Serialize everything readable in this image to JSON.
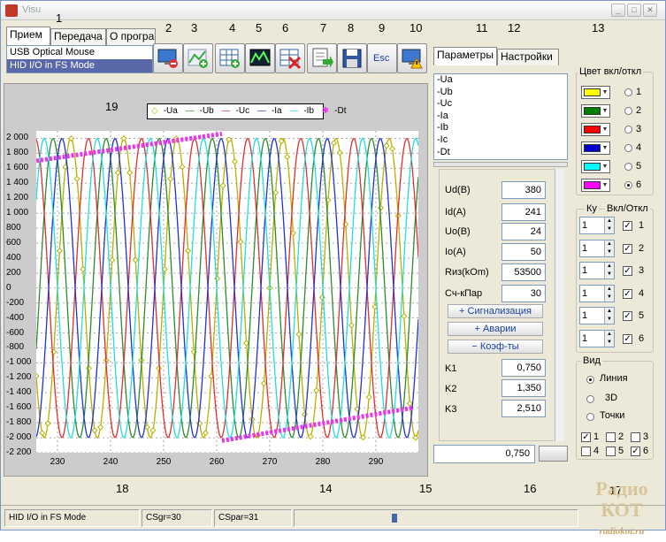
{
  "window": {
    "title": "Visu"
  },
  "tabs_left": [
    "Прием",
    "Передача",
    "О програ"
  ],
  "devices": [
    "USB Optical Mouse",
    "HID I/O in FS Mode"
  ],
  "toolbar": {
    "esc_label": "Esc"
  },
  "callouts": [
    "1",
    "2",
    "3",
    "4",
    "5",
    "6",
    "7",
    "8",
    "9",
    "10",
    "11",
    "12",
    "13",
    "14",
    "15",
    "16",
    "17",
    "18",
    "19"
  ],
  "legend": {
    "items": [
      "-Ua",
      "-Ub",
      "-Uc",
      "-Ia",
      "-Ib",
      "-Dt"
    ]
  },
  "chart_data": {
    "type": "line",
    "title": "",
    "xlabel": "",
    "ylabel": "",
    "xlim": [
      226,
      298
    ],
    "ylim": [
      -2200,
      2100
    ],
    "xticks": [
      230,
      240,
      250,
      260,
      270,
      280,
      290
    ],
    "yticks": [
      2000,
      1800,
      1600,
      1400,
      1200,
      1000,
      800,
      600,
      400,
      200,
      0,
      -200,
      -400,
      -600,
      -800,
      -1000,
      -1200,
      -1400,
      -1600,
      -1800,
      -2000,
      -2200
    ],
    "ytick_labels": [
      "2 000",
      "1 800",
      "1 600",
      "1 400",
      "1 200",
      "1 000",
      "800",
      "600",
      "400",
      "200",
      "0",
      "-200",
      "-400",
      "-600",
      "-800",
      "-1 000",
      "-1 200",
      "-1 400",
      "-1 600",
      "-1 800",
      "-2 000",
      "-2 200"
    ],
    "grid": true,
    "legend_position": "top",
    "series": [
      {
        "name": "-Ua",
        "color": "#b8b000",
        "amplitude": 2000,
        "period": 10,
        "phase": 0
      },
      {
        "name": "-Ub",
        "color": "#2e8b2e",
        "amplitude": 2000,
        "period": 10,
        "phase": 120
      },
      {
        "name": "-Uc",
        "color": "#dd3030",
        "amplitude": 2000,
        "period": 10,
        "phase": 240
      },
      {
        "name": "-Ia",
        "color": "#2233cc",
        "amplitude": 2000,
        "period": 10,
        "phase": 60
      },
      {
        "name": "-Ib",
        "color": "#22dddd",
        "amplitude": 2000,
        "period": 10,
        "phase": 180
      },
      {
        "name": "-Dt",
        "color": "#ee33ee",
        "segments": [
          [
            [
              226,
              1700
            ],
            [
              261,
              2060
            ]
          ],
          [
            [
              261,
              -2040
            ],
            [
              297,
              -1600
            ]
          ]
        ]
      }
    ]
  },
  "right_tabs": [
    "Параметры",
    "Настройки"
  ],
  "channels": [
    "-Ua",
    "-Ub",
    "-Uc",
    "-Ia",
    "-Ib",
    "-Ic",
    "-Dt"
  ],
  "fields": [
    {
      "label": "Ud(B)",
      "value": "380"
    },
    {
      "label": "Id(A)",
      "value": "241"
    },
    {
      "label": "Uo(B)",
      "value": "24"
    },
    {
      "label": "Io(A)",
      "value": "50"
    },
    {
      "label": "Rиз(kOm)",
      "value": "53500"
    },
    {
      "label": "Сч-кПар",
      "value": "30"
    }
  ],
  "sections": [
    "+ Сигнализация",
    "+ Аварии",
    "− Коэф-ты"
  ],
  "coefs": [
    {
      "label": "K1",
      "value": "0,750"
    },
    {
      "label": "K2",
      "value": "1,350"
    },
    {
      "label": "K3",
      "value": "2,510"
    }
  ],
  "bottom_value": "0,750",
  "color_group": {
    "title": "Цвет вкл/откл",
    "colors": [
      "#ffff00",
      "#008000",
      "#ff0000",
      "#0000cc",
      "#00ffff",
      "#ff00ff"
    ],
    "radios": [
      "1",
      "2",
      "3",
      "4",
      "5",
      "6"
    ],
    "selected": "6"
  },
  "ky_group": {
    "title_ky": "Ку",
    "title_onoff": "Вкл/Откл",
    "values": [
      "1",
      "1",
      "1",
      "1",
      "1",
      "1"
    ],
    "labels": [
      "1",
      "2",
      "3",
      "4",
      "5",
      "6"
    ]
  },
  "view_group": {
    "title": "Вид",
    "options": [
      "Линия",
      "3D",
      "Точки"
    ],
    "selected": "Линия",
    "checks": [
      {
        "label": "1",
        "checked": true
      },
      {
        "label": "2",
        "checked": false
      },
      {
        "label": "3",
        "checked": false
      },
      {
        "label": "4",
        "checked": false
      },
      {
        "label": "5",
        "checked": false
      },
      {
        "label": "6",
        "checked": true
      }
    ]
  },
  "status": {
    "device": "HID I/O in FS Mode",
    "csgr": "CSgr=30",
    "cspar": "CSpar=31"
  },
  "logo": {
    "name": "Радио КОТ",
    "url": "radiokot.ru"
  }
}
